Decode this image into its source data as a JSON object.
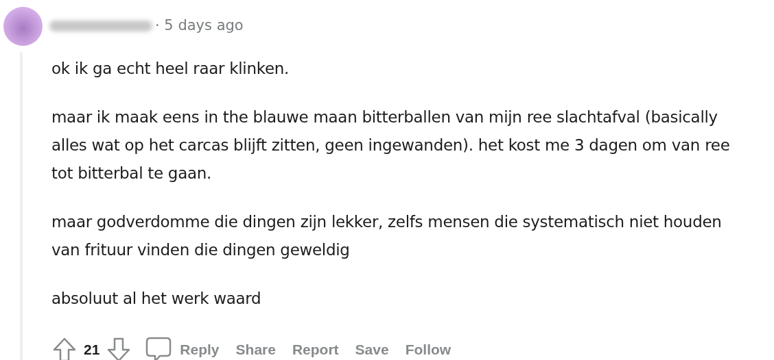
{
  "comment": {
    "time": "· 5 days ago",
    "paragraphs": [
      "ok ik ga echt heel raar klinken.",
      "maar ik maak eens in the blauwe maan bitterballen van mijn ree slachtafval (basically alles wat op het carcas blijft zitten, geen ingewanden). het kost me 3 dagen om van ree tot bitterbal te gaan.",
      "maar godverdomme die dingen zijn lekker, zelfs mensen die systematisch niet houden van frituur vinden die dingen geweldig",
      "absoluut al het werk waard"
    ],
    "score": "21",
    "actions": [
      "Reply",
      "Share",
      "Report",
      "Save",
      "Follow"
    ]
  }
}
